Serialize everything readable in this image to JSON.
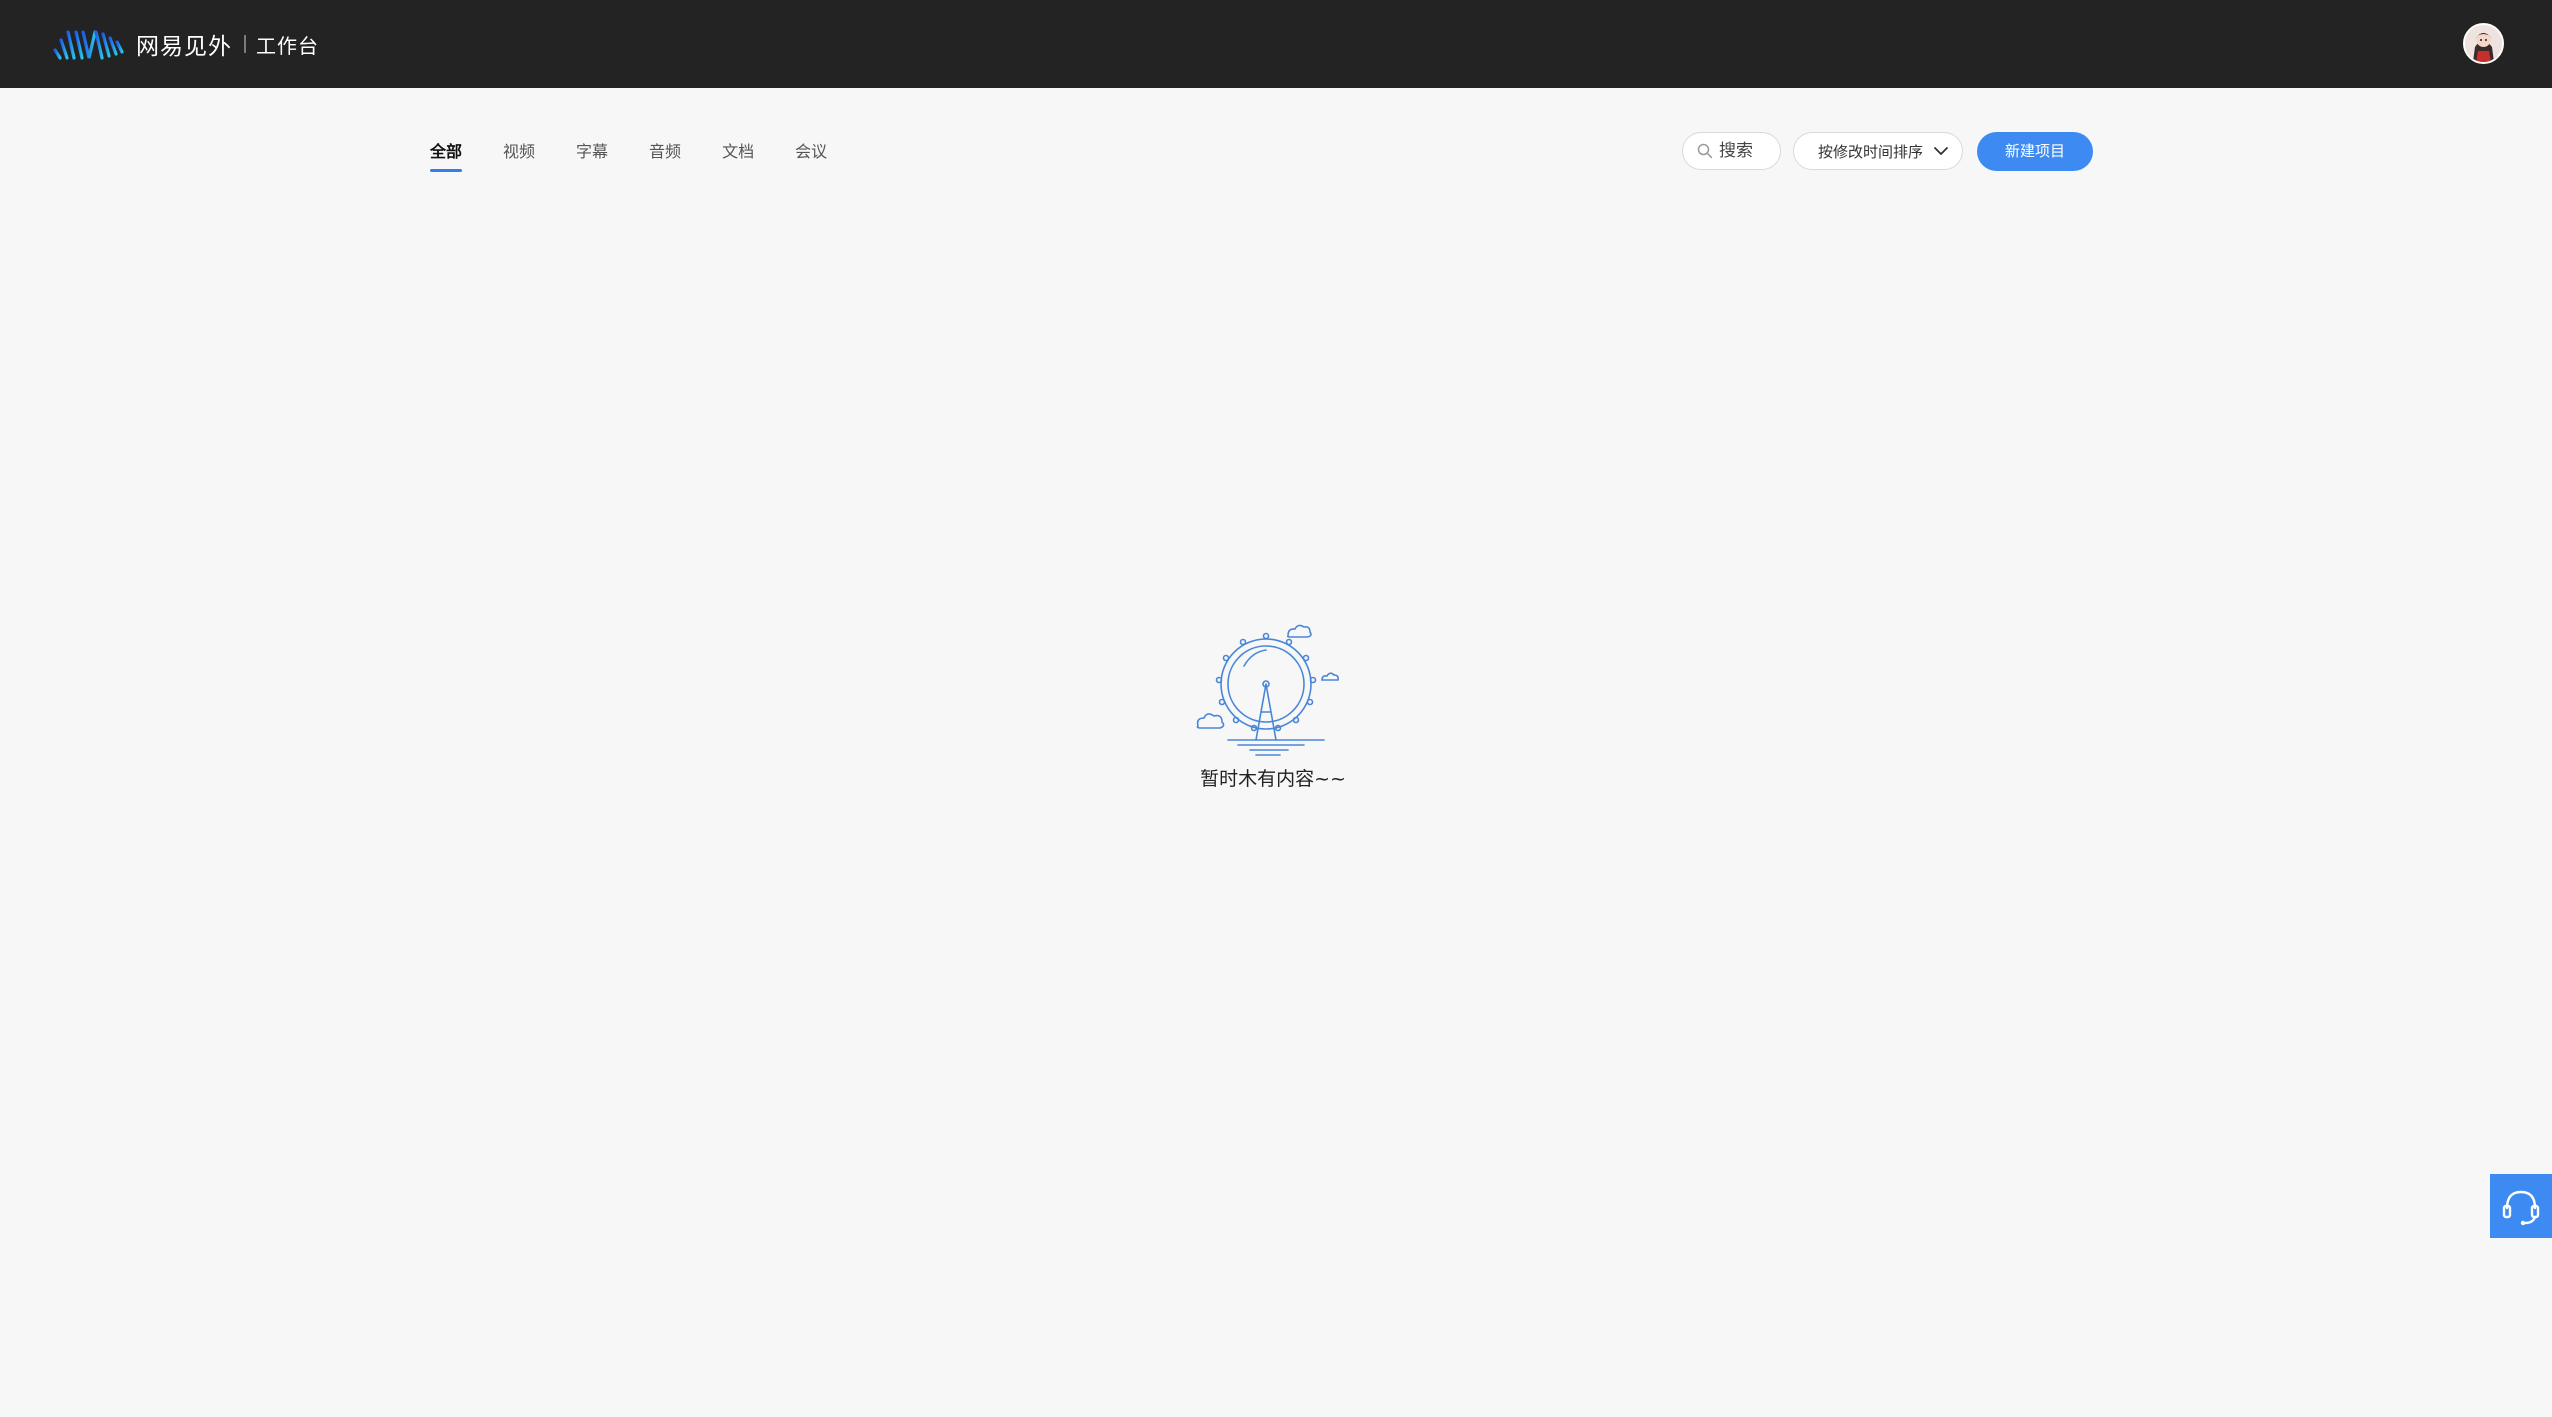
{
  "header": {
    "brand_name": "网易见外",
    "brand_sub": "工作台",
    "avatar_icon": "user-avatar"
  },
  "tabs": [
    {
      "label": "全部",
      "active": true
    },
    {
      "label": "视频",
      "active": false
    },
    {
      "label": "字幕",
      "active": false
    },
    {
      "label": "音频",
      "active": false
    },
    {
      "label": "文档",
      "active": false
    },
    {
      "label": "会议",
      "active": false
    }
  ],
  "toolbar": {
    "search_placeholder": "搜索",
    "sort_label": "按修改时间排序",
    "new_project_label": "新建项目"
  },
  "empty_state": {
    "text": "暂时木有内容~~",
    "illustration_icon": "ferris-wheel-icon"
  },
  "support": {
    "icon": "headset-icon"
  },
  "colors": {
    "topbar": "#232323",
    "background": "#f7f7f7",
    "accent": "#3d8bf2",
    "tab_underline": "#2f80ed"
  }
}
